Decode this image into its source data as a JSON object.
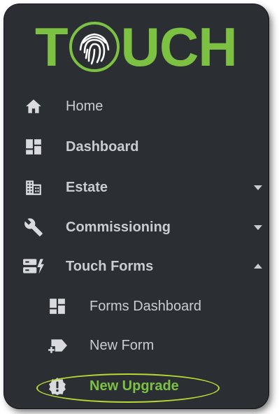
{
  "logo": {
    "letters_left": "T",
    "letters_right": "UCH",
    "icon": "fingerprint-icon",
    "color": "#7cc142"
  },
  "nav": {
    "items": [
      {
        "label": "Home",
        "icon": "home-icon"
      },
      {
        "label": "Dashboard",
        "icon": "dashboard-icon"
      },
      {
        "label": "Estate",
        "icon": "building-icon",
        "expandable": true,
        "expanded": false
      },
      {
        "label": "Commissioning",
        "icon": "wrench-icon",
        "expandable": true,
        "expanded": false
      },
      {
        "label": "Touch Forms",
        "icon": "forms-icon",
        "expandable": true,
        "expanded": true
      }
    ],
    "subitems": [
      {
        "label": "Forms Dashboard",
        "icon": "dashboard-icon"
      },
      {
        "label": "New Form",
        "icon": "new-form-icon"
      },
      {
        "label": "New Upgrade",
        "icon": "upgrade-badge-icon",
        "active": true
      }
    ]
  },
  "colors": {
    "background": "#2b2f34",
    "text": "#c9ccd0",
    "icon": "#d8dadd",
    "accent": "#7cc142",
    "highlight_ring": "#b8d832"
  }
}
